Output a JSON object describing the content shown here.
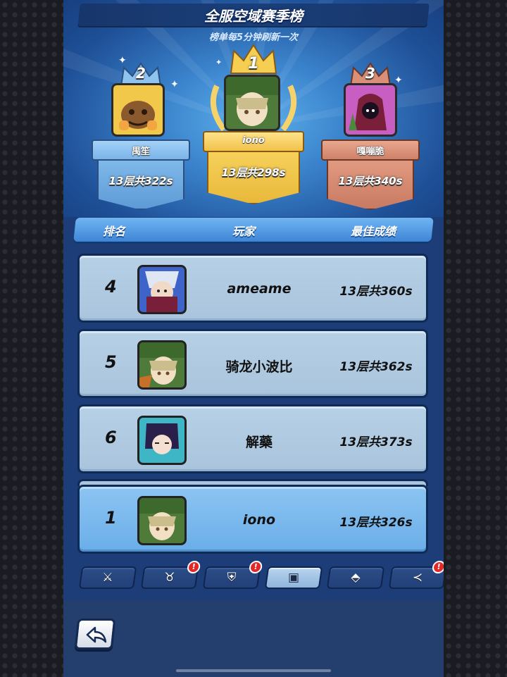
{
  "header": {
    "title": "全服空域赛季榜",
    "subtitle": "榜单每5分钟刷新一次"
  },
  "podium": [
    {
      "rank": "2",
      "name": "禺笙",
      "score": "13层共322s",
      "plate_color": "#8fc3f0",
      "avatar_bg": "#f2c84a"
    },
    {
      "rank": "1",
      "name": "iono",
      "score": "13层共298s",
      "plate_color": "#f6cf52",
      "avatar_bg": "#4e7a3a"
    },
    {
      "rank": "3",
      "name": "嘎嘣脆",
      "score": "13层共340s",
      "plate_color": "#d98f78",
      "avatar_bg": "#c95ec2"
    }
  ],
  "table": {
    "columns": [
      "排名",
      "玩家",
      "最佳成绩"
    ],
    "rows": [
      {
        "rank": "4",
        "name": "ameame",
        "score": "13层共360s",
        "avatar_bg": "#3e63c9"
      },
      {
        "rank": "5",
        "name": "骑龙小波比",
        "score": "13层共362s",
        "avatar_bg": "#4e7a3a"
      },
      {
        "rank": "6",
        "name": "解藥",
        "score": "13层共373s",
        "avatar_bg": "#6a3fb0"
      }
    ],
    "self_row": {
      "rank": "1",
      "name": "iono",
      "score": "13层共326s",
      "avatar_bg": "#4e7a3a"
    }
  },
  "tabs": [
    {
      "icon": "ranking-sword-icon",
      "glyph": "⚔",
      "active": false,
      "alert": false
    },
    {
      "icon": "demon-horn-icon",
      "glyph": "♉",
      "active": false,
      "alert": true
    },
    {
      "icon": "shield-badge-icon",
      "glyph": "⛨",
      "active": false,
      "alert": true
    },
    {
      "icon": "card-rank-icon",
      "glyph": "▣",
      "active": true,
      "alert": false
    },
    {
      "icon": "flag-icon",
      "glyph": "⬘",
      "active": false,
      "alert": false
    },
    {
      "icon": "share-icon",
      "glyph": "≺",
      "active": false,
      "alert": true
    }
  ],
  "footer": {
    "back_icon": "back-arrow-icon"
  }
}
